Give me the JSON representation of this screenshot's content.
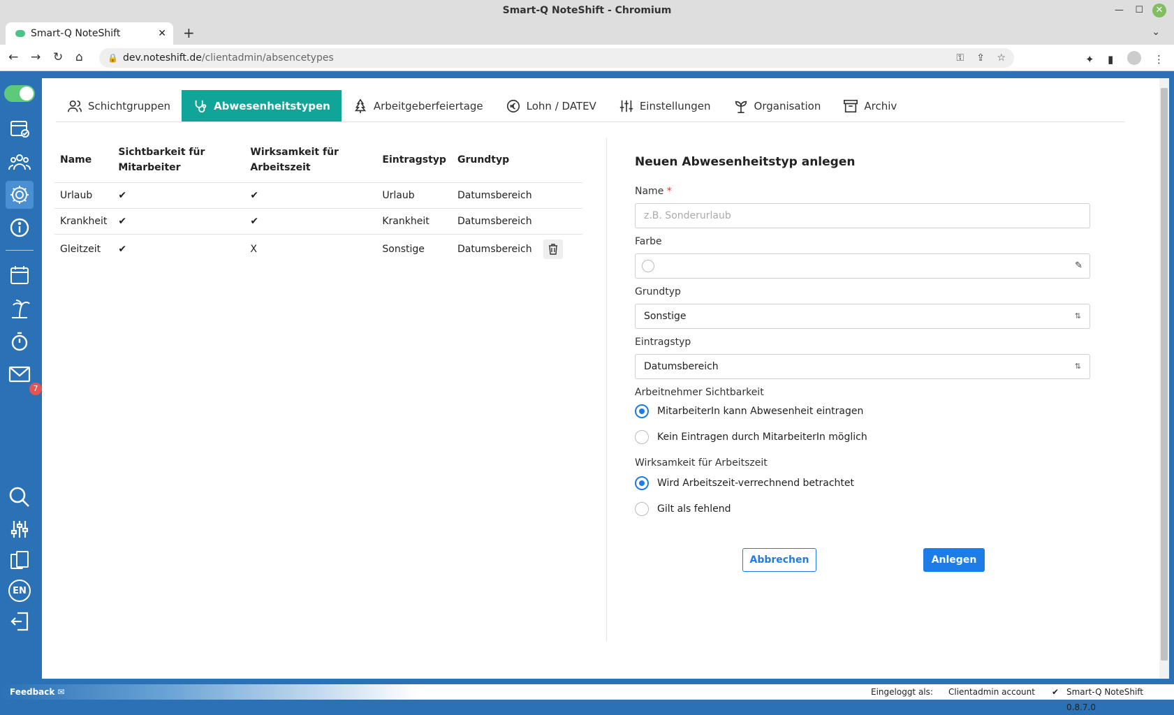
{
  "window": {
    "title": "Smart-Q NoteShift - Chromium"
  },
  "browser": {
    "tab_title": "Smart-Q NoteShift",
    "url_host": "dev.noteshift.de",
    "url_path": "/clientadmin/absencetypes"
  },
  "sidebar": {
    "mail_badge": "7",
    "lang": "EN"
  },
  "tabs": [
    {
      "label": "Schichtgruppen",
      "icon": "users-icon"
    },
    {
      "label": "Abwesenheitstypen",
      "icon": "stethoscope-icon"
    },
    {
      "label": "Arbeitgeberfeiertage",
      "icon": "tree-icon"
    },
    {
      "label": "Lohn / DATEV",
      "icon": "euro-icon"
    },
    {
      "label": "Einstellungen",
      "icon": "sliders-icon"
    },
    {
      "label": "Organisation",
      "icon": "org-icon"
    },
    {
      "label": "Archiv",
      "icon": "archive-icon"
    }
  ],
  "table": {
    "headers": [
      "Name",
      "Sichtbarkeit für Mitarbeiter",
      "Wirksamkeit für Arbeitszeit",
      "Eintragstyp",
      "Grundtyp"
    ],
    "rows": [
      {
        "name": "Urlaub",
        "visibility": "✔",
        "effect": "✔",
        "entry": "Urlaub",
        "base": "Datumsbereich"
      },
      {
        "name": "Krankheit",
        "visibility": "✔",
        "effect": "✔",
        "entry": "Krankheit",
        "base": "Datumsbereich"
      },
      {
        "name": "Gleitzeit",
        "visibility": "✔",
        "effect": "X",
        "entry": "Sonstige",
        "base": "Datumsbereich"
      }
    ]
  },
  "form": {
    "title": "Neuen Abwesenheitstyp anlegen",
    "name_label": "Name",
    "name_required": "*",
    "name_placeholder": "z.B. Sonderurlaub",
    "color_label": "Farbe",
    "base_label": "Grundtyp",
    "base_value": "Sonstige",
    "entry_label": "Eintragstyp",
    "entry_value": "Datumsbereich",
    "visibility_label": "Arbeitnehmer Sichtbarkeit",
    "visibility_opt1": "MitarbeiterIn kann Abwesenheit eintragen",
    "visibility_opt2": "Kein Eintragen durch MitarbeiterIn möglich",
    "effect_label": "Wirksamkeit für Arbeitszeit",
    "effect_opt1": "Wird Arbeitszeit-verrechnend betrachtet",
    "effect_opt2": "Gilt als fehlend",
    "cancel": "Abbrechen",
    "submit": "Anlegen"
  },
  "footer": {
    "feedback": "Feedback",
    "logged_in_label": "Eingeloggt als:",
    "account": "Clientadmin account",
    "version": "Smart-Q NoteShift 0.8.7.0"
  },
  "colors": {
    "accent": "#11a59a",
    "primary": "#1e7ce6",
    "sidebar": "#2a71b5"
  }
}
